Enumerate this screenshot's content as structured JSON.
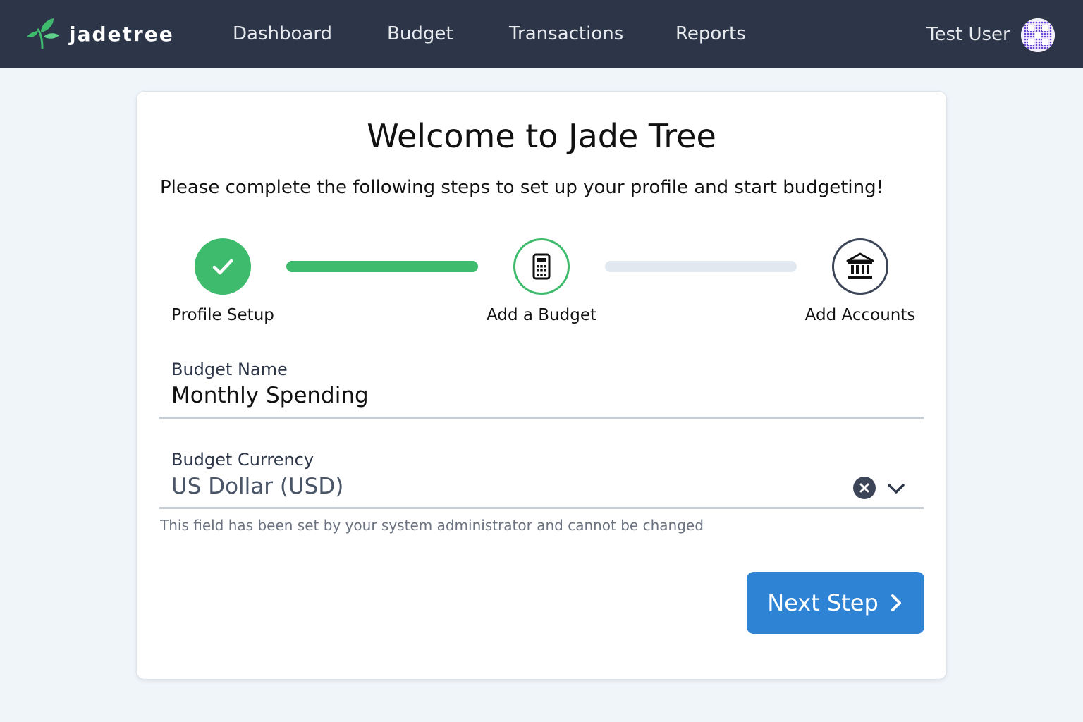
{
  "navbar": {
    "brand": "jadetree",
    "links": [
      "Dashboard",
      "Budget",
      "Transactions",
      "Reports"
    ],
    "user_name": "Test User"
  },
  "onboarding": {
    "title": "Welcome to Jade Tree",
    "subtitle": "Please complete the following steps to set up your profile and start budgeting!",
    "steps": [
      {
        "label": "Profile Setup",
        "status": "complete",
        "icon": "check-icon"
      },
      {
        "label": "Add a Budget",
        "status": "current",
        "icon": "calculator-icon"
      },
      {
        "label": "Add Accounts",
        "status": "upcoming",
        "icon": "bank-icon"
      }
    ],
    "connectors": [
      {
        "progress": 1.0
      },
      {
        "progress": 0.0
      }
    ]
  },
  "form": {
    "budget_name": {
      "label": "Budget Name",
      "value": "Monthly Spending"
    },
    "budget_currency": {
      "label": "Budget Currency",
      "value": "US Dollar (USD)",
      "help": "This field has been set by your system administrator and cannot be changed"
    },
    "next_button": "Next Step"
  },
  "colors": {
    "navbar": "#2d3648",
    "accent_green": "#3fbb6d",
    "primary_blue": "#2f83d5",
    "background": "#f0f5fa"
  }
}
